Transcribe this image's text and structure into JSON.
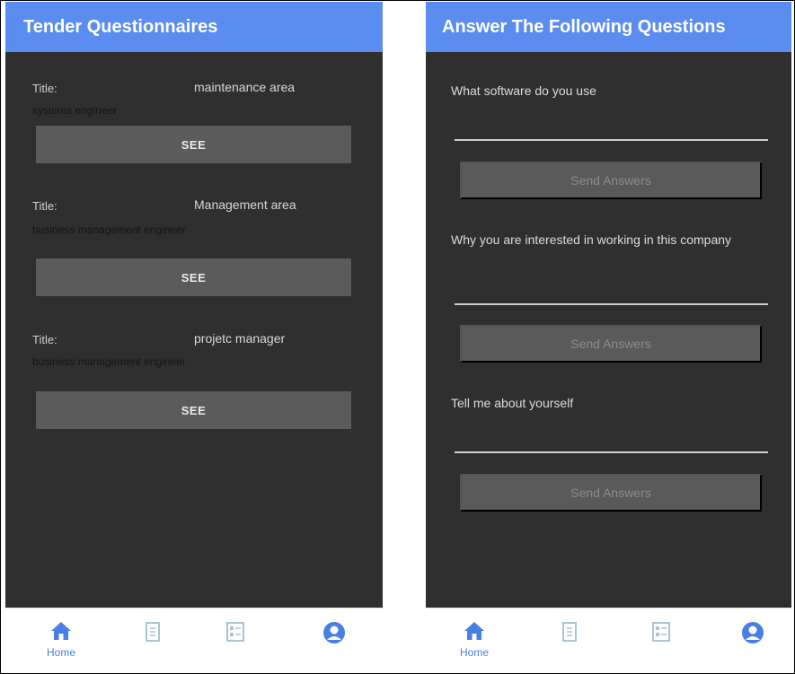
{
  "left_screen": {
    "title": "Tender Questionnaires",
    "items": [
      {
        "label": "Title:",
        "value": "maintenance area",
        "subtitle": "systems engineer",
        "button": "SEE"
      },
      {
        "label": "Title:",
        "value": "Management area",
        "subtitle": "business management engineer",
        "button": "SEE"
      },
      {
        "label": "Title:",
        "value": "projetc manager",
        "subtitle": "business management engineer",
        "button": "SEE"
      }
    ],
    "nav": {
      "home_label": "Home"
    }
  },
  "right_screen": {
    "title": "Answer The Following Questions",
    "questions": [
      {
        "text": "What software do you use",
        "button": "Send Answers"
      },
      {
        "text": "Why you are interested in working in this company",
        "button": "Send Answers"
      },
      {
        "text": "Tell me about yourself",
        "button": "Send Answers"
      }
    ],
    "nav": {
      "home_label": "Home"
    }
  },
  "colors": {
    "header": "#5b8df0",
    "background": "#303030",
    "nav_active": "#4a7ee6",
    "nav_inactive": "#a9c6cf"
  },
  "nav_icons": [
    "home-icon",
    "document-icon",
    "checklist-icon",
    "account-circle-icon"
  ]
}
